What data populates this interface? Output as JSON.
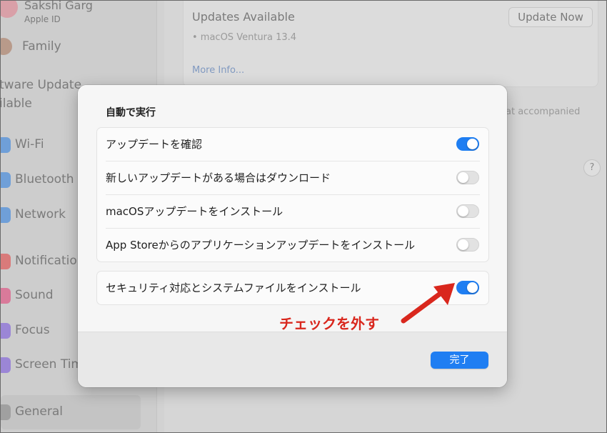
{
  "sidebar": {
    "account_name": "Sakshi Garg",
    "account_sub": "Apple ID",
    "family": "Family",
    "update_line1": "tware Update",
    "update_line2": "ilable",
    "items": [
      {
        "label": "Wi-Fi",
        "icon": "wifi-icon",
        "color": "#6f9fd8"
      },
      {
        "label": "Bluetooth",
        "icon": "bluetooth-icon",
        "color": "#6f9fd8"
      },
      {
        "label": "Network",
        "icon": "network-icon",
        "color": "#6f9fd8"
      },
      {
        "label": "Notificatio",
        "icon": "notifications-icon",
        "color": "#d97a7a"
      },
      {
        "label": "Sound",
        "icon": "sound-icon",
        "color": "#d97a9a"
      },
      {
        "label": "Focus",
        "icon": "focus-icon",
        "color": "#9b86d6"
      },
      {
        "label": "Screen Tim",
        "icon": "screen-time-icon",
        "color": "#9b86d6"
      },
      {
        "label": "General",
        "icon": "general-icon",
        "color": "#a0a0a0"
      }
    ]
  },
  "main": {
    "updates_title": "Updates Available",
    "update_item": "• macOS Ventura 13.4",
    "update_now_button": "Update Now",
    "more_info_link": "More Info...",
    "partial_text": "at accompanied",
    "help_glyph": "?"
  },
  "dialog": {
    "title": "自動で実行",
    "rows": [
      {
        "label": "アップデートを確認",
        "on": true
      },
      {
        "label": "新しいアップデートがある場合はダウンロード",
        "on": false
      },
      {
        "label": "macOSアップデートをインストール",
        "on": false
      },
      {
        "label": "App Storeからのアプリケーションアップデートをインストール",
        "on": false
      }
    ],
    "security_row": {
      "label": "セキュリティ対応とシステムファイルをインストール",
      "on": true
    },
    "done_button": "完了"
  },
  "annotation": {
    "text": "チェックを外す",
    "color": "#d9271d"
  },
  "colors": {
    "accent": "#1f7ef2"
  }
}
